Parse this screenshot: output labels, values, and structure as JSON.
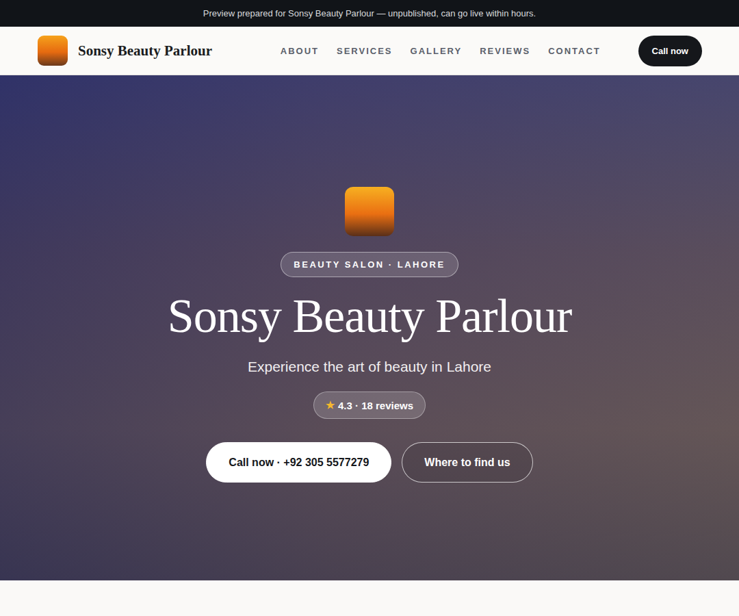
{
  "banner": {
    "text": "Preview prepared for Sonsy Beauty Parlour — unpublished, can go live within hours."
  },
  "nav": {
    "brand": "Sonsy Beauty Parlour",
    "links": [
      "ABOUT",
      "SERVICES",
      "GALLERY",
      "REVIEWS",
      "CONTACT"
    ],
    "cta": "Call now"
  },
  "hero": {
    "badge": "BEAUTY SALON · LAHORE",
    "title": "Sonsy Beauty Parlour",
    "subtitle": "Experience the art of beauty in Lahore",
    "rating": {
      "icon": "★",
      "text": "4.3 · 18 reviews"
    },
    "buttons": [
      {
        "label": "Call now · +92 305 5577279",
        "kind": "primary"
      },
      {
        "label": "Where to find us",
        "kind": "outline"
      }
    ]
  }
}
